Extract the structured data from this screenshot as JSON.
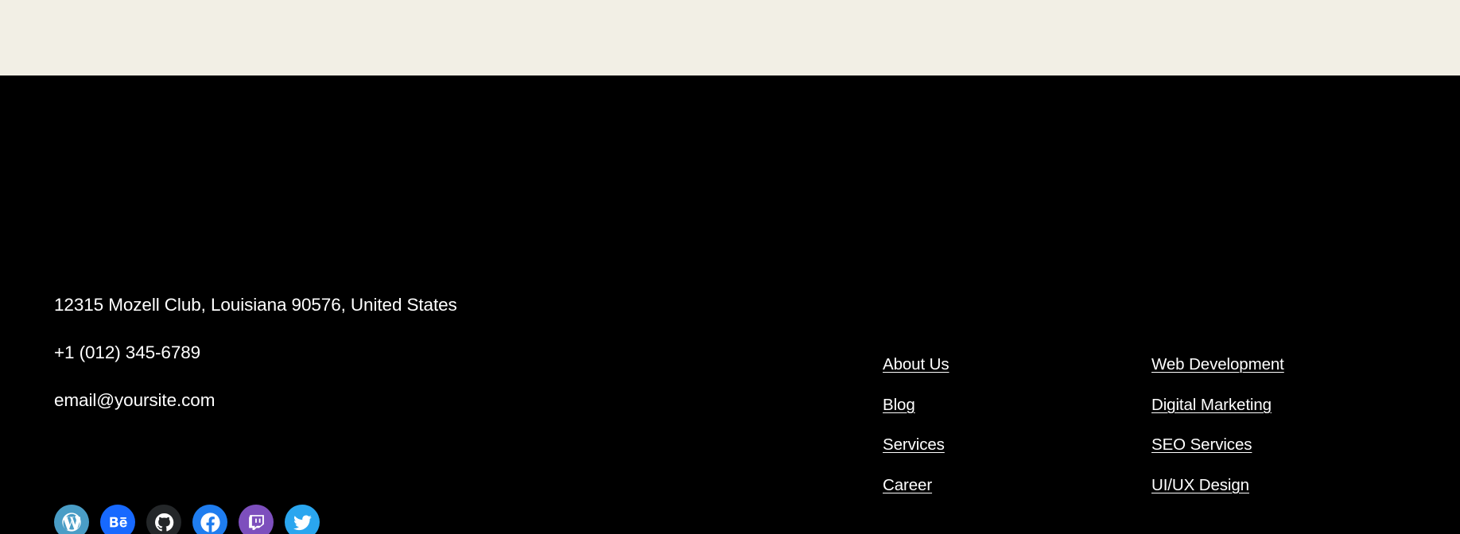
{
  "page": {
    "background_color": "#000000",
    "top_band_color": "#f2efe5",
    "text_color": "#ffffff"
  },
  "footer": {
    "contact": {
      "address": "12315 Mozell Club, Louisiana 90576, United States",
      "phone": "+1 (012) 345-6789",
      "email": "email@yoursite.com"
    },
    "social": [
      {
        "name": "wordpress-icon",
        "label": "WordPress",
        "color": "#4a9dc6"
      },
      {
        "name": "behance-icon",
        "label": "Behance",
        "color": "#1769ff"
      },
      {
        "name": "github-icon",
        "label": "GitHub",
        "color": "#242729"
      },
      {
        "name": "facebook-icon",
        "label": "Facebook",
        "color": "#1f7def"
      },
      {
        "name": "twitch-icon",
        "label": "Twitch",
        "color": "#7d4fbd"
      },
      {
        "name": "twitter-icon",
        "label": "Twitter",
        "color": "#2aa6ef"
      }
    ],
    "link_columns": [
      {
        "id": "company",
        "links": [
          {
            "label": "About Us"
          },
          {
            "label": "Blog"
          },
          {
            "label": "Services"
          },
          {
            "label": "Career"
          }
        ]
      },
      {
        "id": "services",
        "links": [
          {
            "label": "Web Development"
          },
          {
            "label": "Digital Marketing"
          },
          {
            "label": "SEO Services"
          },
          {
            "label": "UI/UX Design"
          }
        ]
      }
    ]
  }
}
